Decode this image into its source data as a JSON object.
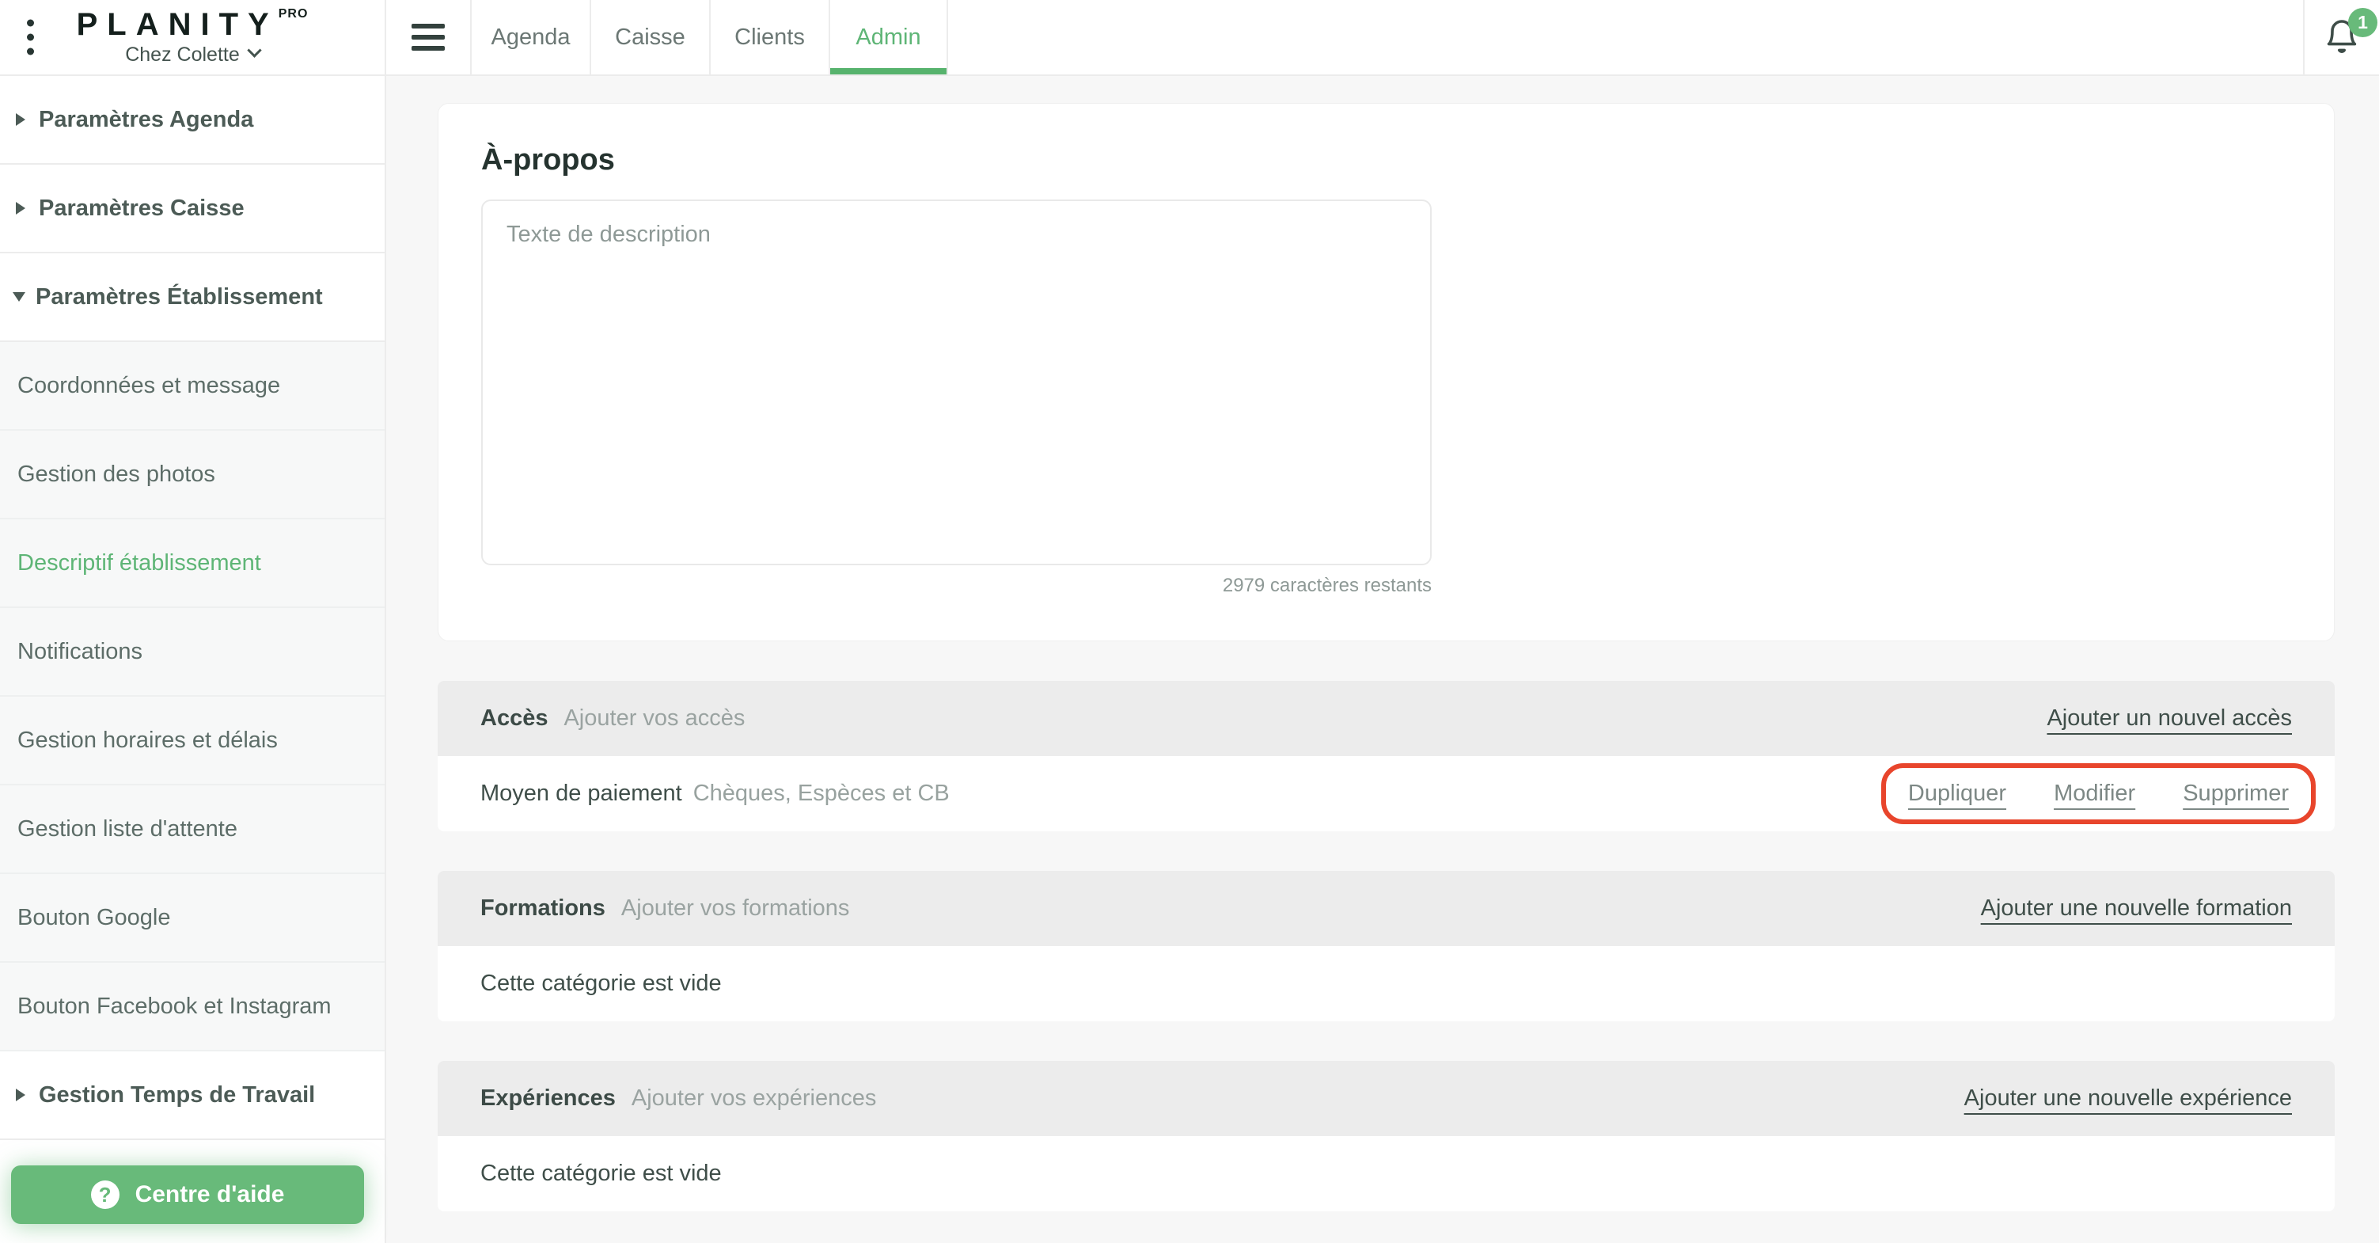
{
  "brand": {
    "logo": "PLANITY",
    "logo_suffix": "PRO",
    "account": "Chez Colette"
  },
  "topnav": {
    "tabs": [
      {
        "label": "Agenda",
        "active": false
      },
      {
        "label": "Caisse",
        "active": false
      },
      {
        "label": "Clients",
        "active": false
      },
      {
        "label": "Admin",
        "active": true
      }
    ],
    "notification_count": "1"
  },
  "sidebar": {
    "items": [
      {
        "label": "Paramètres Agenda",
        "type": "header",
        "state": "collapsed"
      },
      {
        "label": "Paramètres Caisse",
        "type": "header",
        "state": "collapsed"
      },
      {
        "label": "Paramètres Établissement",
        "type": "header",
        "state": "expanded"
      },
      {
        "label": "Coordonnées et message",
        "type": "sub",
        "active": false
      },
      {
        "label": "Gestion des photos",
        "type": "sub",
        "active": false
      },
      {
        "label": "Descriptif établissement",
        "type": "sub",
        "active": true
      },
      {
        "label": "Notifications",
        "type": "sub",
        "active": false
      },
      {
        "label": "Gestion horaires et délais",
        "type": "sub",
        "active": false
      },
      {
        "label": "Gestion liste d'attente",
        "type": "sub",
        "active": false
      },
      {
        "label": "Bouton Google",
        "type": "sub",
        "active": false
      },
      {
        "label": "Bouton Facebook et Instagram",
        "type": "sub",
        "active": false
      },
      {
        "label": "Gestion Temps de Travail",
        "type": "header",
        "state": "collapsed"
      }
    ],
    "help_button": {
      "label": "Centre d'aide",
      "icon_glyph": "?"
    }
  },
  "about": {
    "title": "À-propos",
    "placeholder": "Texte de description",
    "counter": "2979 caractères restants"
  },
  "sections": [
    {
      "title": "Accès",
      "subtitle": "Ajouter vos accès",
      "action": "Ajouter un nouvel accès",
      "rows": [
        {
          "name": "Moyen de paiement",
          "value": "Chèques, Espèces et CB",
          "actions": [
            "Dupliquer",
            "Modifier",
            "Supprimer"
          ],
          "highlighted": true
        }
      ]
    },
    {
      "title": "Formations",
      "subtitle": "Ajouter vos formations",
      "action": "Ajouter une nouvelle formation",
      "empty": "Cette catégorie est vide"
    },
    {
      "title": "Expériences",
      "subtitle": "Ajouter vos expériences",
      "action": "Ajouter une nouvelle expérience",
      "empty": "Cette catégorie est vide"
    }
  ],
  "colors": {
    "accent_green": "#5eb576",
    "button_green": "#68ba7a",
    "highlight_red": "#e8452c",
    "section_header_bg": "#ececec",
    "page_bg": "#f7f7f7"
  }
}
